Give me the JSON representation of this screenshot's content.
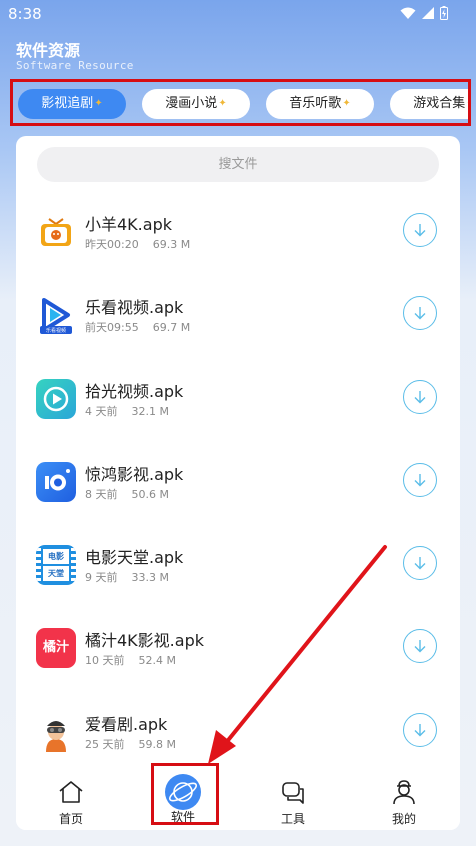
{
  "status": {
    "time": "8:38"
  },
  "header": {
    "title": "软件资源",
    "subtitle": "Software Resource"
  },
  "tabs": [
    {
      "label": "影视追剧",
      "active": true
    },
    {
      "label": "漫画小说",
      "active": false
    },
    {
      "label": "音乐听歌",
      "active": false
    },
    {
      "label": "游戏合集",
      "active": false
    }
  ],
  "search": {
    "placeholder": "搜文件"
  },
  "files": [
    {
      "name": "小羊4K.apk",
      "date": "昨天00:20",
      "size": "69.3 M",
      "icon": "tv-sheep-icon"
    },
    {
      "name": "乐看视频.apk",
      "date": "前天09:55",
      "size": "69.7 M",
      "icon": "play-blue-icon"
    },
    {
      "name": "拾光视频.apk",
      "date": "4 天前",
      "size": "32.1 M",
      "icon": "play-teal-icon"
    },
    {
      "name": "惊鸿影视.apk",
      "date": "8 天前",
      "size": "50.6 M",
      "icon": "camera-blue-icon"
    },
    {
      "name": "电影天堂.apk",
      "date": "9 天前",
      "size": "33.3 M",
      "icon": "film-strip-icon"
    },
    {
      "name": "橘汁4K影视.apk",
      "date": "10 天前",
      "size": "52.4 M",
      "icon": "juzhi-logo-icon"
    },
    {
      "name": "爱看剧.apk",
      "date": "25 天前",
      "size": "59.8 M",
      "icon": "avatar-vr-icon"
    }
  ],
  "icon_labels": {
    "movie_heaven_top": "电影",
    "movie_heaven_bottom": "天堂",
    "juzhi": "橘汁",
    "lekan": "乐看视频"
  },
  "nav": [
    {
      "label": "首页",
      "icon": "home-icon"
    },
    {
      "label": "软件",
      "icon": "planet-icon",
      "active": true
    },
    {
      "label": "工具",
      "icon": "chat-icon"
    },
    {
      "label": "我的",
      "icon": "user-icon"
    }
  ],
  "colors": {
    "accent": "#3e89f2",
    "download": "#5bbde8",
    "highlight": "#d60d13"
  }
}
